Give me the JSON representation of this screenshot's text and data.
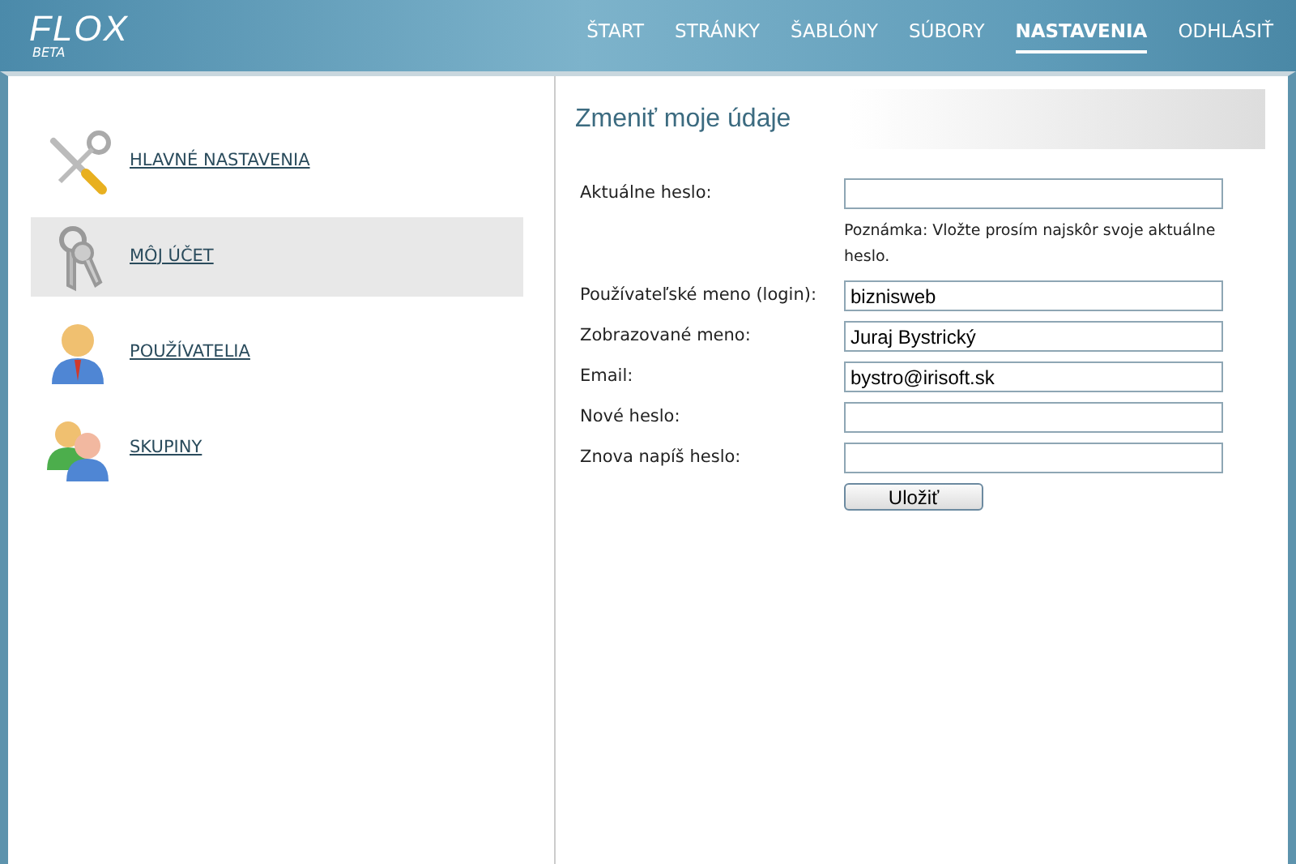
{
  "logo": {
    "name": "FLOX",
    "tag": "BETA"
  },
  "nav": [
    {
      "label": "ŠTART",
      "selected": false
    },
    {
      "label": "STRÁNKY",
      "selected": false
    },
    {
      "label": "ŠABLÓNY",
      "selected": false
    },
    {
      "label": "SÚBORY",
      "selected": false
    },
    {
      "label": "NASTAVENIA",
      "selected": true
    },
    {
      "label": "ODHLÁSIŤ",
      "selected": false
    }
  ],
  "sidebar": {
    "items": [
      {
        "label": "HLAVNÉ NASTAVENIA",
        "kind": "tools",
        "selected": false
      },
      {
        "label": "MÔJ ÚČET",
        "kind": "keys",
        "selected": true
      },
      {
        "label": "POUŽÍVATELIA",
        "kind": "user",
        "selected": false
      },
      {
        "label": "SKUPINY",
        "kind": "group",
        "selected": false
      }
    ]
  },
  "form": {
    "title": "Zmeniť moje údaje",
    "rows": [
      {
        "kind": "field",
        "label": "Aktuálne heslo:"
      },
      {
        "kind": "note",
        "text": "Poznámka: Vložte prosím najskôr svoje aktuálne heslo."
      },
      {
        "kind": "field",
        "label": "Používateľské meno (login):",
        "value": "biznisweb"
      },
      {
        "kind": "field",
        "label": "Zobrazované meno:",
        "value": "Juraj Bystrický"
      },
      {
        "kind": "field",
        "label": "Email:",
        "value": "bystro@irisoft.sk"
      },
      {
        "kind": "field",
        "label": "Nové heslo:"
      },
      {
        "kind": "field",
        "label": "Znova napíš heslo:"
      }
    ],
    "button": "Uložiť"
  }
}
